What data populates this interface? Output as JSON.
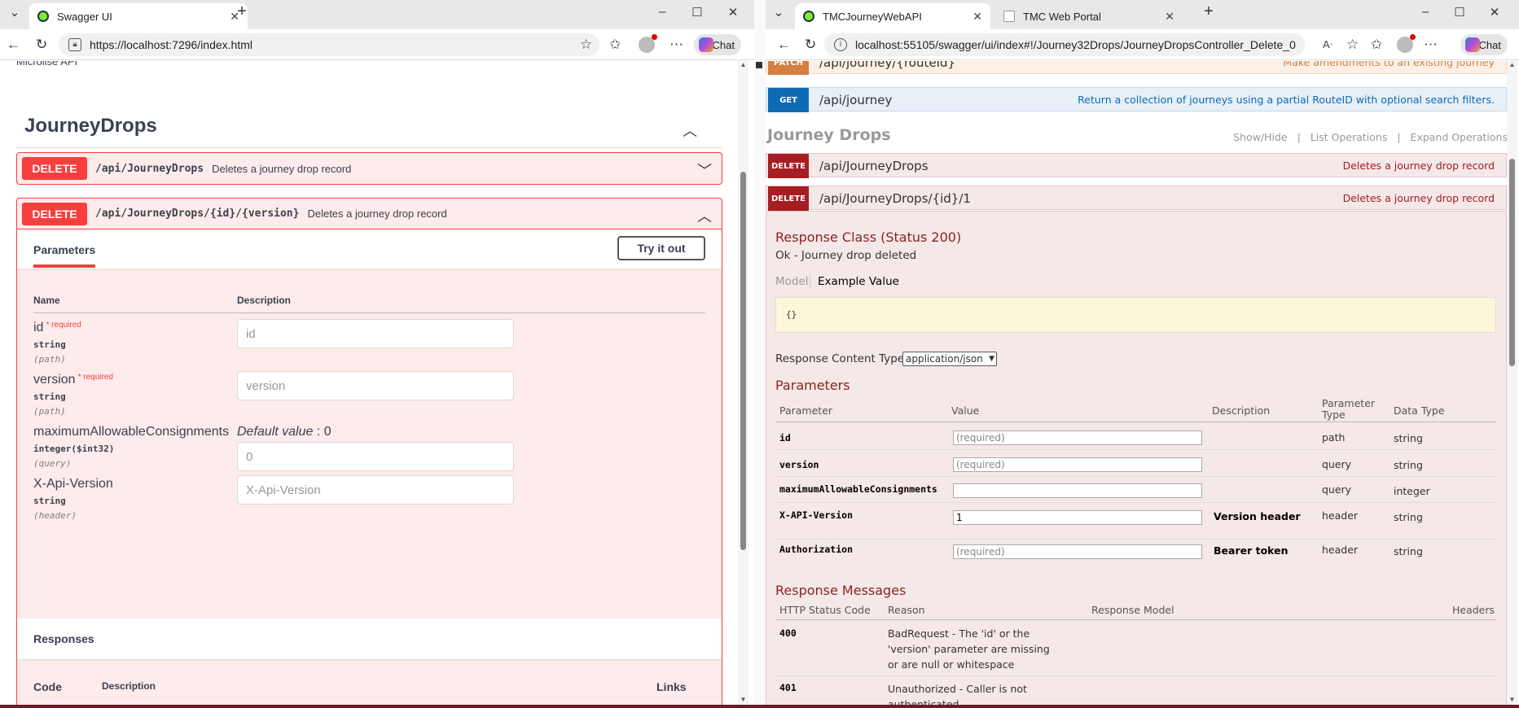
{
  "left_window": {
    "tab_title": "Swagger UI",
    "url": "https://localhost:7296/index.html",
    "chat_label": "Chat",
    "top_partial_text": "Microlise API",
    "tag_title": "JourneyDrops",
    "operations": [
      {
        "method": "DELETE",
        "path": "/api/JourneyDrops",
        "summary": "Deletes a journey drop record"
      },
      {
        "method": "DELETE",
        "path": "/api/JourneyDrops/{id}/{version}",
        "summary": "Deletes a journey drop record"
      }
    ],
    "parameters_tab": "Parameters",
    "try_it_out": "Try it out",
    "col_name": "Name",
    "col_description": "Description",
    "required_marker": "*",
    "required_label": "required",
    "params": [
      {
        "name": "id",
        "type": "string",
        "in": "(path)",
        "placeholder": "id"
      },
      {
        "name": "version",
        "type": "string",
        "in": "(path)",
        "placeholder": "version"
      },
      {
        "name": "maximumAllowableConsignments",
        "type": "integer($int32)",
        "in": "(query)",
        "placeholder": "0",
        "default_label": "Default value",
        "default_value": ": 0"
      },
      {
        "name": "X-Api-Version",
        "type": "string",
        "in": "(header)",
        "placeholder": "X-Api-Version"
      }
    ],
    "responses_title": "Responses",
    "resp_col_code": "Code",
    "resp_col_desc": "Description",
    "resp_col_links": "Links"
  },
  "right_window": {
    "tab1_title": "TMCJourneyWebAPI",
    "tab2_title": "TMC Web Portal",
    "url": "localhost:55105/swagger/ui/index#!/Journey32Drops/JourneyDropsController_Delete_0",
    "chat_label": "Chat",
    "top_ops": [
      {
        "method": "PATCH",
        "path": "/api/journey/{routeId}",
        "desc": "Make amendments to an existing journey"
      },
      {
        "method": "GET",
        "path": "/api/journey",
        "desc": "Return a collection of journeys using a partial RouteID with optional search filters."
      }
    ],
    "section_title": "Journey Drops",
    "links": [
      "Show/Hide",
      "|",
      "List Operations",
      "|",
      "Expand Operations"
    ],
    "ops": [
      {
        "method": "DELETE",
        "path": "/api/JourneyDrops",
        "desc": "Deletes a journey drop record"
      },
      {
        "method": "DELETE",
        "path": "/api/JourneyDrops/{id}/1",
        "desc": "Deletes a journey drop record"
      }
    ],
    "response_class": "Response Class (Status 200)",
    "response_class_desc": "Ok - Journey drop deleted",
    "model_tab": "Model",
    "example_tab": "Example Value",
    "example_value": "{}",
    "content_type_label": "Response Content Type",
    "content_type_value": "application/json",
    "params_title": "Parameters",
    "param_headers": {
      "parameter": "Parameter",
      "value": "Value",
      "description": "Description",
      "param_type_1": "Parameter",
      "param_type_2": "Type",
      "data_type": "Data Type"
    },
    "params": [
      {
        "name": "id",
        "value": "(required)",
        "description": "",
        "type": "path",
        "data_type": "string"
      },
      {
        "name": "version",
        "value": "(required)",
        "description": "",
        "type": "query",
        "data_type": "string"
      },
      {
        "name": "maximumAllowableConsignments",
        "value": "",
        "description": "",
        "type": "query",
        "data_type": "integer"
      },
      {
        "name": "X-API-Version",
        "value": "1",
        "description": "Version header",
        "type": "header",
        "data_type": "string"
      },
      {
        "name": "Authorization",
        "value": "(required)",
        "description": "Bearer token",
        "type": "header",
        "data_type": "string"
      }
    ],
    "messages_title": "Response Messages",
    "msg_headers": {
      "code": "HTTP Status Code",
      "reason": "Reason",
      "model": "Response Model",
      "headers": "Headers"
    },
    "messages": [
      {
        "code": "400",
        "reason": "BadRequest - The 'id' or the 'version' parameter are missing or are null or whitespace"
      },
      {
        "code": "401",
        "reason": "Unauthorized - Caller is not authenticated"
      }
    ]
  },
  "colors": {
    "delete": "#f93e3e",
    "old_delete": "#a41e22",
    "get": "#0f6ab4",
    "patch": "#d38042"
  }
}
